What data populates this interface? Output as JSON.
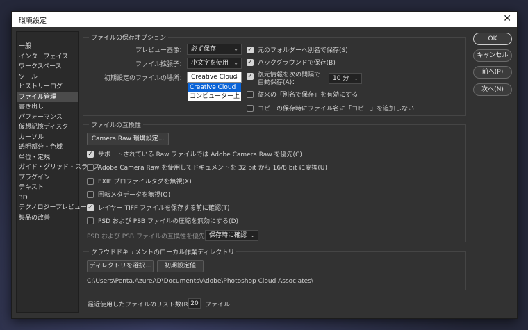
{
  "window": {
    "title": "環境設定",
    "close_label": "✕"
  },
  "sidebar": {
    "items": [
      {
        "label": "一般"
      },
      {
        "label": "インターフェイス"
      },
      {
        "label": "ワークスペース"
      },
      {
        "label": "ツール"
      },
      {
        "label": "ヒストリーログ"
      },
      {
        "label": "ファイル管理"
      },
      {
        "label": "書き出し"
      },
      {
        "label": "パフォーマンス"
      },
      {
        "label": "仮想記憶ディスク"
      },
      {
        "label": "カーソル"
      },
      {
        "label": "透明部分・色域"
      },
      {
        "label": "単位・定規"
      },
      {
        "label": "ガイド・グリッド・スライス"
      },
      {
        "label": "プラグイン"
      },
      {
        "label": "テキスト"
      },
      {
        "label": "3D"
      },
      {
        "label": "テクノロジープレビュー"
      },
      {
        "label": "製品の改善"
      }
    ],
    "active": "ファイル管理"
  },
  "save_options": {
    "title": "ファイルの保存オプション",
    "preview_label": "プレビュー画像：",
    "preview_value": "必ず保存",
    "extension_label": "ファイル拡張子：",
    "extension_value": "小文字を使用",
    "location_label": "初期設定のファイルの場所：",
    "location_value": "Creative Cloud",
    "location_options": [
      "Creative Cloud",
      "コンピューター上"
    ],
    "save_as_original_folder": {
      "label": "元のフォルダーへ別名で保存(S)",
      "checked": true
    },
    "background_save": {
      "label": "バックグラウンドで保存(B)",
      "checked": true
    },
    "autosave_line1": "復元情報を次の間隔で",
    "autosave_line2": "自動保存(A)：",
    "autosave_checked": true,
    "autosave_interval": "10 分",
    "legacy_save_as": {
      "label": "従来の「別名で保存」を有効にする",
      "checked": false
    },
    "no_copy_suffix": {
      "label": "コピーの保存時にファイル名に「コピー」を追加しない",
      "checked": false
    }
  },
  "compat": {
    "title": "ファイルの互換性",
    "camera_raw_button": "Camera Raw 環境設定...",
    "options": [
      {
        "label": "サポートされている Raw ファイルでは Adobe Camera Raw を優先(C)",
        "checked": true
      },
      {
        "label": "Adobe Camera Raw を使用してドキュメントを 32 bit から 16/8 bit に変換(U)",
        "checked": false
      },
      {
        "label": "EXIF プロファイルタグを無視(X)",
        "checked": false
      },
      {
        "label": "回転メタデータを無視(O)",
        "checked": false
      },
      {
        "label": "レイヤー TIFF ファイルを保存する前に確認(T)",
        "checked": true
      },
      {
        "label": "PSD および PSB ファイルの圧縮を無効にする(D)",
        "checked": false
      }
    ],
    "maximize_label": "PSD および PSB ファイルの互換性を優先：",
    "maximize_value": "保存時に確認"
  },
  "cloud": {
    "title": "クラウドドキュメントのローカル作業ディレクトリ",
    "choose_button": "ディレクトリを選択...",
    "default_button": "初期設定値",
    "path": "C:\\Users\\Penta.AzureAD\\Documents\\Adobe\\Photoshop Cloud Associates\\"
  },
  "recent": {
    "label": "最近使用したファイルのリスト数(R)：",
    "value": "20",
    "unit": "ファイル"
  },
  "buttons": {
    "ok": "OK",
    "cancel": "キャンセル",
    "prev": "前へ(P)",
    "next": "次へ(N)"
  }
}
